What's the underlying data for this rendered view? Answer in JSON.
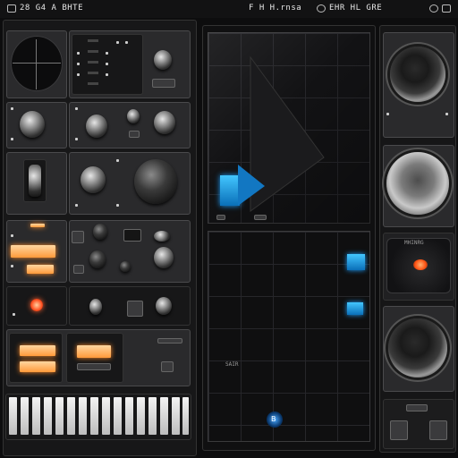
{
  "top_bar": {
    "left_label": "28 G4 A BHTE",
    "center_label": "F H  H.rnsa",
    "right_label": "EHR HL GRE",
    "icons": [
      "meter-icon",
      "power-icon",
      "settings-icon",
      "menu-icon"
    ]
  },
  "visualizer": {
    "footer_label": "SAIR",
    "bottom_badge": "B"
  },
  "right_rack": {
    "meter_label": "MHINRG"
  },
  "colors": {
    "accent_orange": "#ff9a3a",
    "accent_blue": "#1ea0ff",
    "panel": "#2a2a2c",
    "background": "#0d0d0e"
  }
}
